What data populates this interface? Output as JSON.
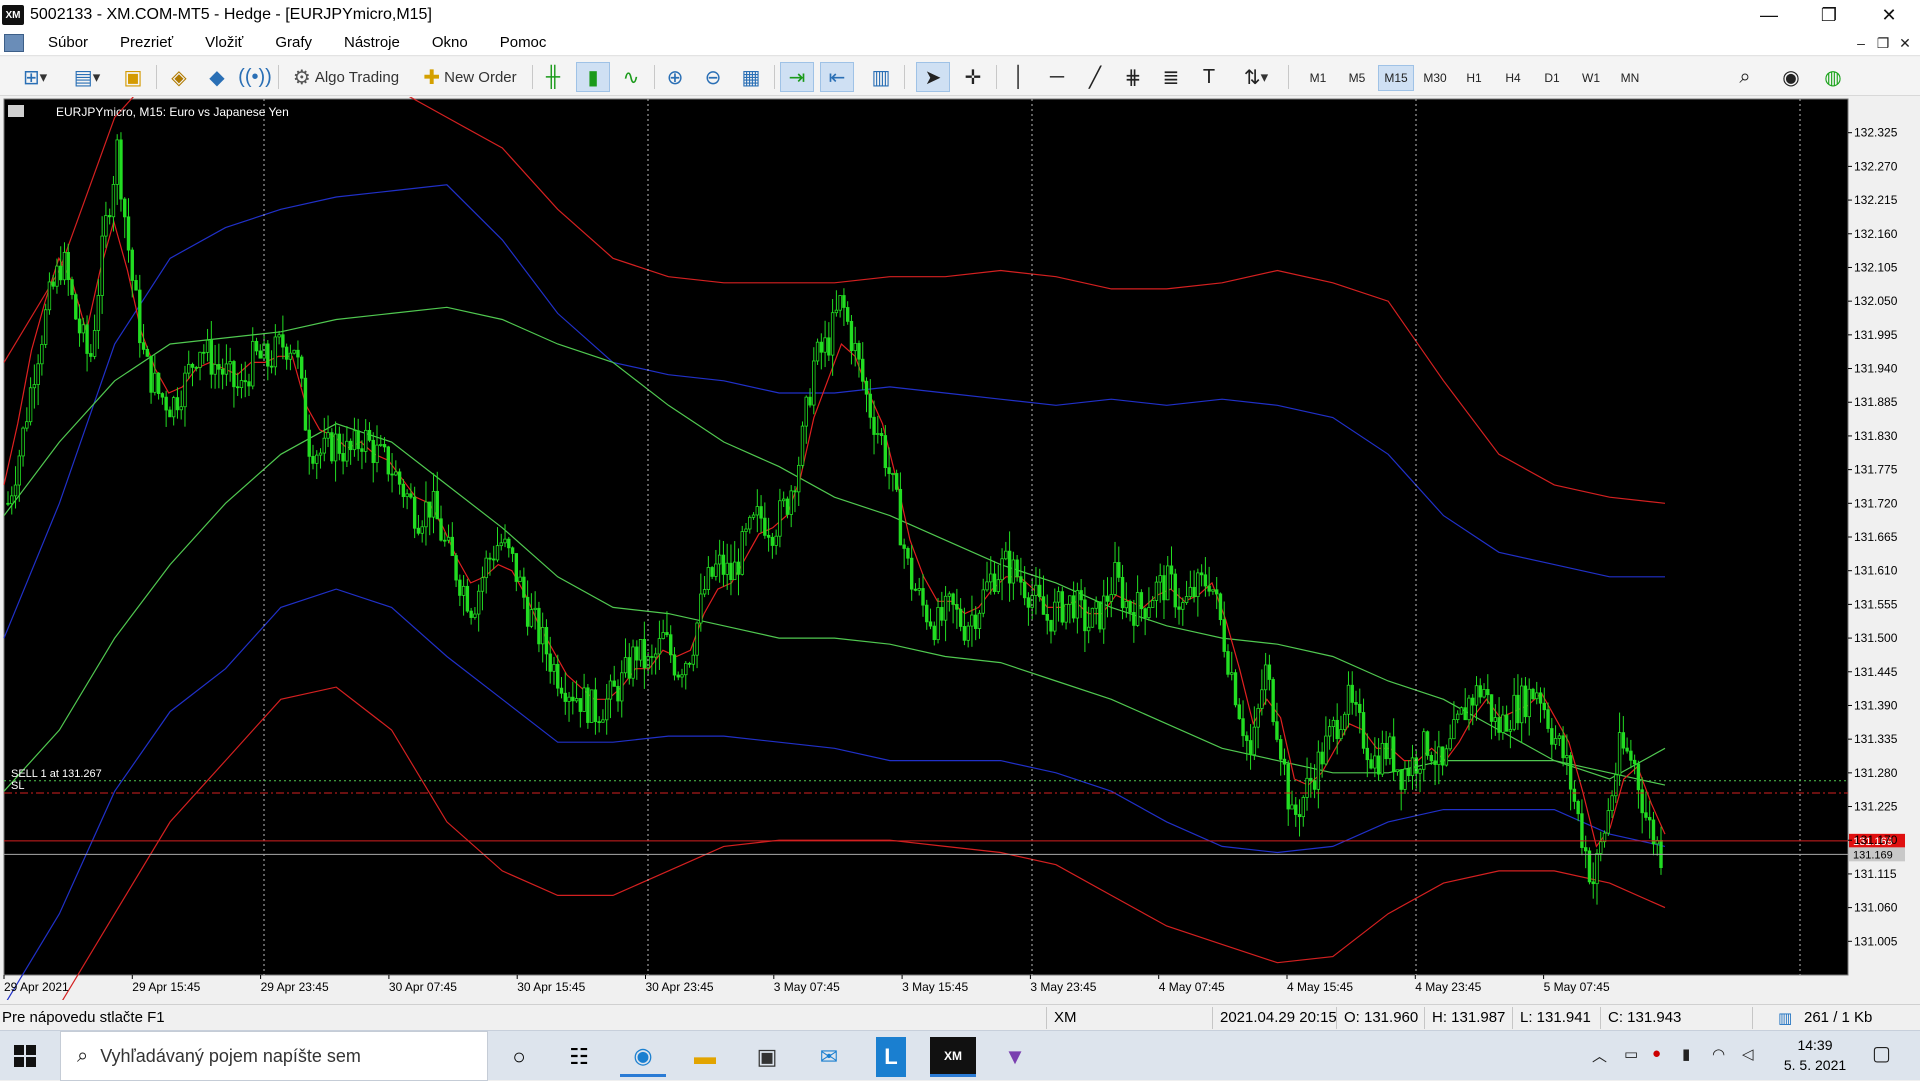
{
  "window": {
    "title": "5002133 - XM.COM-MT5 - Hedge - [EURJPYmicro,M15]",
    "logo": "XM",
    "controls": {
      "minimize": "—",
      "restore": "❐",
      "close": "✕"
    }
  },
  "menu": {
    "items": [
      "Súbor",
      "Prezrieť",
      "Vložiť",
      "Grafy",
      "Nástroje",
      "Okno",
      "Pomoc"
    ],
    "mdi_controls": {
      "minimize": "–",
      "restore": "❐",
      "close": "✕"
    }
  },
  "toolbar": {
    "algo_trading_label": "Algo Trading",
    "new_order_label": "New Order",
    "timeframes": [
      "M1",
      "M5",
      "M15",
      "M30",
      "H1",
      "H4",
      "D1",
      "W1",
      "MN"
    ],
    "active_timeframe": "M15"
  },
  "chart_data": {
    "type": "candlestick",
    "title": "EURJPYmicro, M15:  Euro vs Japanese Yen",
    "y_ticks": [
      "132.325",
      "132.270",
      "132.215",
      "132.160",
      "132.105",
      "132.050",
      "131.995",
      "131.940",
      "131.885",
      "131.830",
      "131.775",
      "131.720",
      "131.665",
      "131.610",
      "131.555",
      "131.500",
      "131.445",
      "131.390",
      "131.335",
      "131.280",
      "131.225",
      "131.170",
      "131.115",
      "131.060",
      "131.005"
    ],
    "ylim": [
      130.95,
      132.38
    ],
    "x_ticks": [
      "29 Apr 2021",
      "29 Apr 15:45",
      "29 Apr 23:45",
      "30 Apr 07:45",
      "30 Apr 15:45",
      "30 Apr 23:45",
      "3 May 07:45",
      "3 May 15:45",
      "3 May 23:45",
      "4 May 07:45",
      "4 May 15:45",
      "4 May 23:45",
      "5 May 07:45"
    ],
    "trade_label": "SELL 1 at 131.267",
    "sl_label": "SL",
    "trade_price": 131.267,
    "sl_price": 131.247,
    "bid_price": "131.169",
    "ask_price": "131.169",
    "bid_value": 131.169,
    "ask_value": 131.147,
    "price_path": [
      131.72,
      131.82,
      131.95,
      132.05,
      132.12,
      132.02,
      131.95,
      132.15,
      132.3,
      132.1,
      131.95,
      131.9,
      131.88,
      131.92,
      131.98,
      131.95,
      131.93,
      131.9,
      131.96,
      131.95,
      131.98,
      131.98,
      131.82,
      131.8,
      131.82,
      131.8,
      131.83,
      131.8,
      131.78,
      131.74,
      131.7,
      131.72,
      131.65,
      131.6,
      131.55,
      131.62,
      131.66,
      131.62,
      131.55,
      131.5,
      131.45,
      131.42,
      131.4,
      131.38,
      131.4,
      131.43,
      131.48,
      131.45,
      131.5,
      131.45,
      131.48,
      131.58,
      131.62,
      131.6,
      131.66,
      131.7,
      131.68,
      131.72,
      131.8,
      131.95,
      131.98,
      132.05,
      131.97,
      131.88,
      131.82,
      131.72,
      131.6,
      131.55,
      131.52,
      131.55,
      131.52,
      131.55,
      131.6,
      131.62,
      131.6,
      131.57,
      131.53,
      131.55,
      131.56,
      131.52,
      131.54,
      131.6,
      131.55,
      131.55,
      131.58,
      131.59,
      131.55,
      131.58,
      131.6,
      131.5,
      131.4,
      131.3,
      131.45,
      131.35,
      131.2,
      131.25,
      131.3,
      131.35,
      131.4,
      131.35,
      131.3,
      131.32,
      131.28,
      131.3,
      131.33,
      131.28,
      131.35,
      131.4,
      131.42,
      131.35,
      131.38,
      131.4,
      131.42,
      131.35,
      131.3,
      131.2,
      131.1,
      131.2,
      131.32,
      131.3,
      131.2,
      131.15
    ],
    "indicators": {
      "ma_red": [
        131.75,
        131.85,
        131.97,
        132.05,
        132.12,
        132.08,
        132.0,
        132.1,
        132.18,
        132.1,
        132.0,
        131.94,
        131.9,
        131.91,
        131.94,
        131.95,
        131.94,
        131.93,
        131.95,
        131.95,
        131.96,
        131.96,
        131.88,
        131.84,
        131.83,
        131.81,
        131.82,
        131.8,
        131.79,
        131.76,
        131.73,
        131.72,
        131.68,
        131.63,
        131.59,
        131.6,
        131.62,
        131.61,
        131.57,
        131.52,
        131.48,
        131.44,
        131.42,
        131.4,
        131.4,
        131.42,
        131.45,
        131.45,
        131.48,
        131.47,
        131.48,
        131.54,
        131.58,
        131.59,
        131.63,
        131.67,
        131.68,
        131.7,
        131.76,
        131.86,
        131.92,
        131.98,
        131.96,
        131.9,
        131.85,
        131.76,
        131.66,
        131.6,
        131.56,
        131.56,
        131.54,
        131.55,
        131.58,
        131.6,
        131.6,
        131.58,
        131.55,
        131.55,
        131.56,
        131.54,
        131.54,
        131.57,
        131.56,
        131.55,
        131.57,
        131.58,
        131.56,
        131.57,
        131.59,
        131.53,
        131.45,
        131.36,
        131.4,
        131.37,
        131.27,
        131.26,
        131.28,
        131.32,
        131.36,
        131.35,
        131.32,
        131.32,
        131.3,
        131.3,
        131.32,
        131.3,
        131.33,
        131.37,
        131.4,
        131.37,
        131.38,
        131.39,
        131.41,
        131.37,
        131.33,
        131.25,
        131.16,
        131.19,
        131.27,
        131.29,
        131.23,
        131.18
      ],
      "bands_green": [
        [
          131.7,
          131.82,
          131.92,
          131.98,
          131.99,
          132.0,
          132.02,
          132.03,
          132.04,
          132.02,
          131.98,
          131.95,
          131.88,
          131.82,
          131.78,
          131.73,
          131.7,
          131.66,
          131.62,
          131.59,
          131.55,
          131.52,
          131.5,
          131.49,
          131.47,
          131.43,
          131.4,
          131.35,
          131.3,
          131.27,
          131.32
        ],
        [
          131.25,
          131.35,
          131.5,
          131.62,
          131.72,
          131.8,
          131.85,
          131.82,
          131.75,
          131.68,
          131.6,
          131.55,
          131.54,
          131.52,
          131.5,
          131.5,
          131.49,
          131.47,
          131.46,
          131.43,
          131.4,
          131.36,
          131.32,
          131.3,
          131.28,
          131.28,
          131.3,
          131.3,
          131.3,
          131.28,
          131.26
        ]
      ],
      "bands_blue": [
        [
          131.5,
          131.72,
          131.98,
          132.12,
          132.17,
          132.2,
          132.22,
          132.23,
          132.24,
          132.15,
          132.03,
          131.95,
          131.93,
          131.92,
          131.9,
          131.9,
          131.91,
          131.9,
          131.89,
          131.88,
          131.89,
          131.88,
          131.89,
          131.88,
          131.86,
          131.8,
          131.7,
          131.64,
          131.62,
          131.6,
          131.6
        ],
        [
          130.9,
          131.05,
          131.25,
          131.38,
          131.45,
          131.55,
          131.58,
          131.55,
          131.47,
          131.4,
          131.33,
          131.33,
          131.34,
          131.34,
          131.33,
          131.32,
          131.3,
          131.3,
          131.3,
          131.28,
          131.25,
          131.2,
          131.16,
          131.15,
          131.16,
          131.2,
          131.22,
          131.22,
          131.22,
          131.18,
          131.16
        ]
      ],
      "bands_red": [
        [
          131.95,
          132.1,
          132.35,
          132.45,
          132.48,
          132.5,
          132.42,
          132.4,
          132.35,
          132.3,
          132.2,
          132.12,
          132.09,
          132.08,
          132.08,
          132.08,
          132.09,
          132.09,
          132.1,
          132.09,
          132.07,
          132.07,
          132.08,
          132.1,
          132.08,
          132.05,
          131.92,
          131.8,
          131.75,
          131.73,
          131.72
        ],
        [
          130.75,
          130.9,
          131.05,
          131.2,
          131.3,
          131.4,
          131.42,
          131.35,
          131.2,
          131.12,
          131.08,
          131.08,
          131.12,
          131.16,
          131.17,
          131.17,
          131.17,
          131.16,
          131.15,
          131.13,
          131.08,
          131.03,
          131.0,
          130.97,
          130.98,
          131.05,
          131.1,
          131.12,
          131.12,
          131.1,
          131.06
        ]
      ]
    }
  },
  "status": {
    "help_text": "Pre nápovedu stlačte F1",
    "server": "XM",
    "datetime": "2021.04.29 20:15",
    "open": "O: 131.960",
    "high": "H: 131.987",
    "low": "L: 131.941",
    "close": "C: 131.943",
    "traffic": "261 / 1 Kb"
  },
  "taskbar": {
    "search_placeholder": "Vyhľadávaný pojem napíšte sem",
    "time": "14:39",
    "date": "5. 5. 2021"
  }
}
